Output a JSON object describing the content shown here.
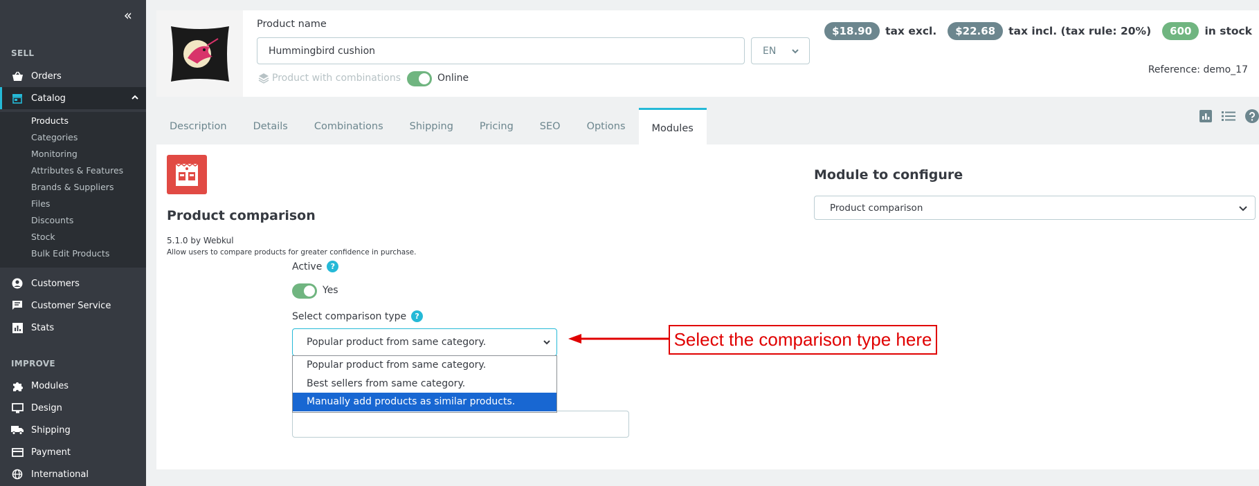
{
  "sidebar": {
    "collapse_label": "«",
    "sections": {
      "sell": "SELL",
      "improve": "IMPROVE"
    },
    "items": {
      "orders": "Orders",
      "catalog": "Catalog",
      "customers": "Customers",
      "customer_service": "Customer Service",
      "stats": "Stats",
      "modules": "Modules",
      "design": "Design",
      "shipping": "Shipping",
      "payment": "Payment",
      "international": "International"
    },
    "catalog_submenu": {
      "products": "Products",
      "categories": "Categories",
      "monitoring": "Monitoring",
      "attributes": "Attributes & Features",
      "brands": "Brands & Suppliers",
      "files": "Files",
      "discounts": "Discounts",
      "stock": "Stock",
      "bulk_edit": "Bulk Edit Products"
    }
  },
  "header": {
    "product_name_label": "Product name",
    "product_name_value": "Hummingbird cushion",
    "language": "EN",
    "combinations_label": "Product with combinations",
    "online_label": "Online",
    "online": true,
    "price_excl": "$18.90",
    "price_excl_label": "tax excl.",
    "price_incl": "$22.68",
    "price_incl_label": "tax incl. (tax rule: 20%)",
    "stock_qty": "600",
    "stock_label": "in stock",
    "reference": "Reference: demo_17"
  },
  "tabs": {
    "description": "Description",
    "details": "Details",
    "combinations": "Combinations",
    "shipping": "Shipping",
    "pricing": "Pricing",
    "seo": "SEO",
    "options": "Options",
    "modules": "Modules"
  },
  "module": {
    "title": "Product comparison",
    "version": "5.1.0 by Webkul",
    "description": "Allow users to compare products for greater confidence in purchase.",
    "active_label": "Active",
    "active_value": "Yes",
    "active": true,
    "comparison_label": "Select comparison type",
    "comparison_selected": "Popular product from same category.",
    "comparison_options": [
      "Popular product from same category.",
      "Best sellers from same category.",
      "Manually add products as similar products."
    ],
    "highlighted_option": "Manually add products as similar products."
  },
  "configure": {
    "label": "Module to configure",
    "selected": "Product comparison"
  },
  "annotation": {
    "text": "Select the comparison type here"
  },
  "colors": {
    "sidebar_bg": "#363a41",
    "accent": "#25b9d7",
    "success": "#70b580",
    "annotation": "#e00000",
    "highlight": "#1867d2"
  }
}
